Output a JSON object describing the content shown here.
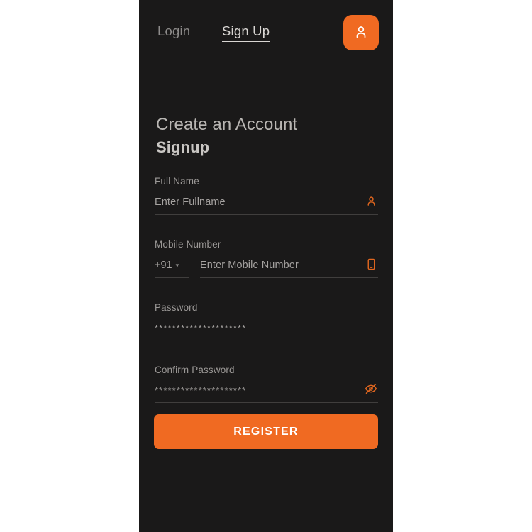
{
  "app": {
    "background_color": "#1a1919",
    "accent_color": "#f06a22",
    "page_background": "#ffffff"
  },
  "header": {
    "tabs": [
      {
        "label": "Login",
        "active": false
      },
      {
        "label": "Sign Up",
        "active": true
      }
    ],
    "avatar_button": {
      "icon": "user-icon",
      "background": "#f06a22"
    }
  },
  "heading": {
    "subtitle": "Create an Account",
    "title": "Signup"
  },
  "form": {
    "fields": [
      {
        "label": "Full Name",
        "placeholder": "Enter Fullname",
        "value": "",
        "icon": "user-icon"
      },
      {
        "label": "Mobile Number",
        "country_code": "+91",
        "country_code_caret": "chevron-down-icon",
        "placeholder": "Enter Mobile Number",
        "value": "",
        "icon": "phone-icon"
      },
      {
        "label": "Password",
        "value": "*********************",
        "icon": null
      },
      {
        "label": "Confirm Password",
        "value": "*********************",
        "icon": "eye-off-icon"
      }
    ]
  },
  "actions": {
    "register_label": "REGISTER"
  }
}
